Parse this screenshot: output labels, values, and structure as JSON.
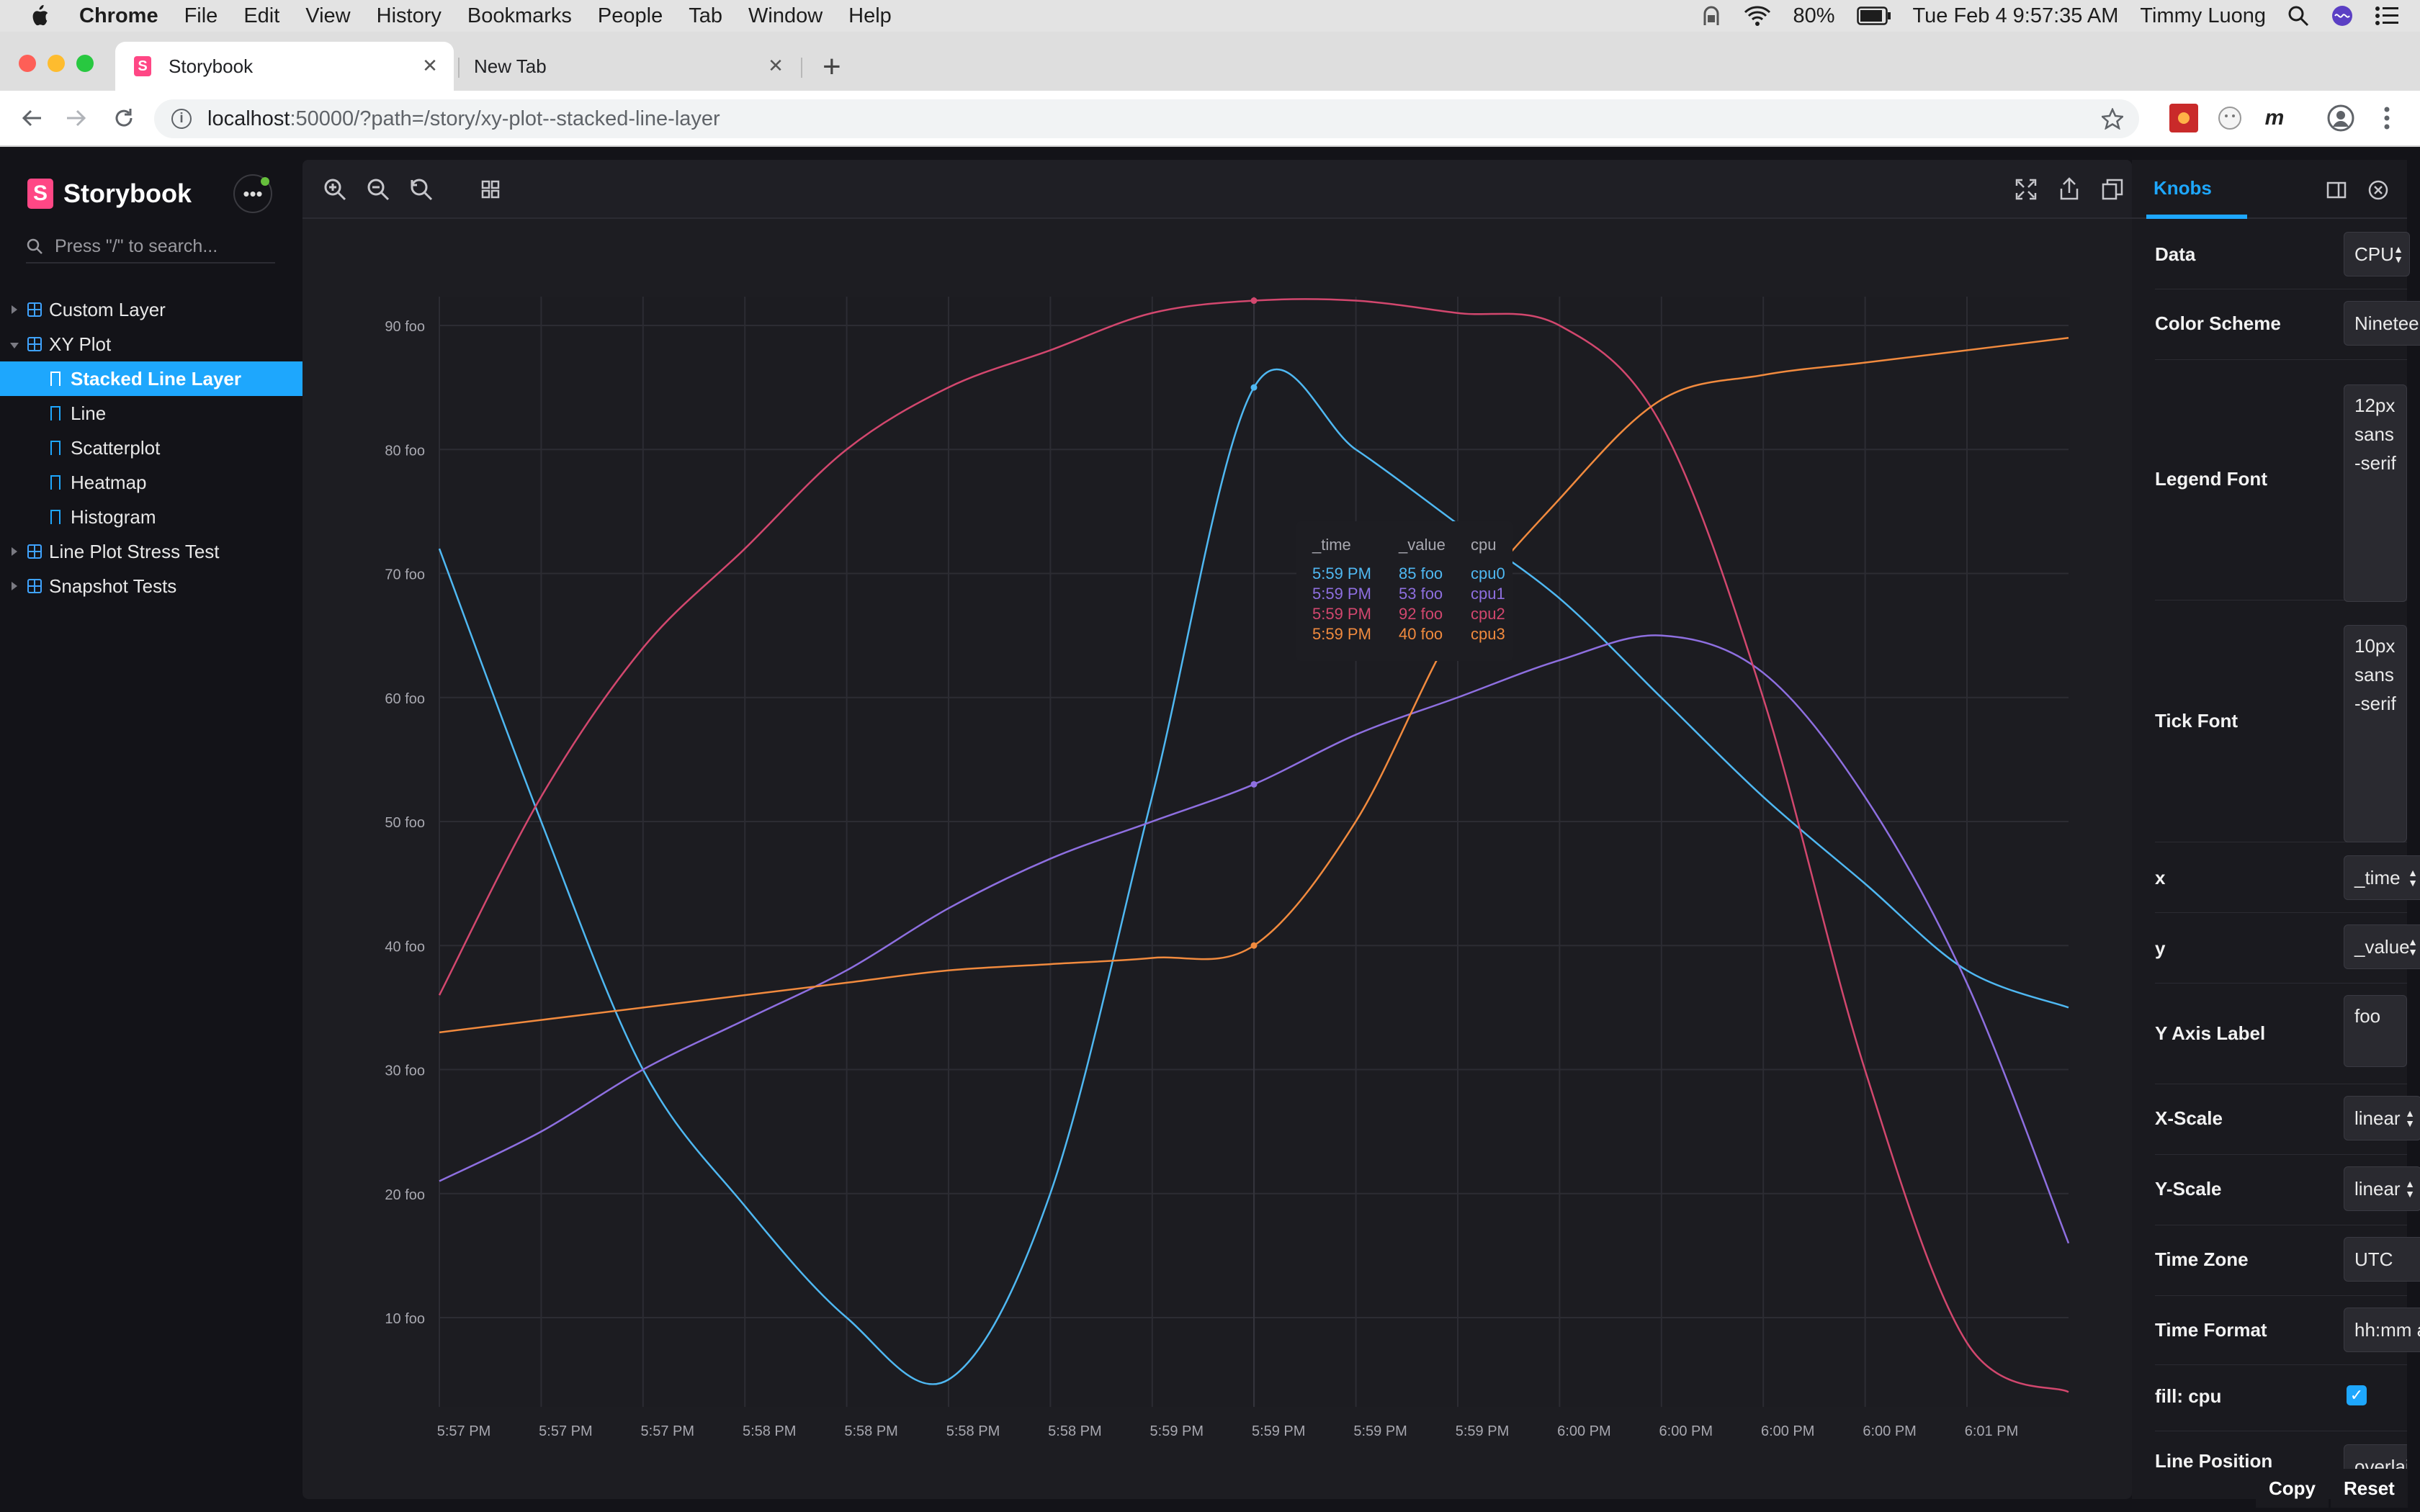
{
  "menubar": {
    "app": "Chrome",
    "items": [
      "File",
      "Edit",
      "View",
      "History",
      "Bookmarks",
      "People",
      "Tab",
      "Window",
      "Help"
    ],
    "battery": "80%",
    "datetime": "Tue Feb 4  9:57:35 AM",
    "user": "Timmy Luong"
  },
  "tabs": [
    {
      "title": "Storybook"
    },
    {
      "title": "New Tab"
    }
  ],
  "address": {
    "host": "localhost",
    "rest": ":50000/?path=/story/xy-plot--stacked-line-layer"
  },
  "extensions": {
    "m_label": "m"
  },
  "sidebar": {
    "brand": "Storybook",
    "search_placeholder": "Press \"/\" to search...",
    "tree": [
      {
        "label": "Custom Layer",
        "kind": "component"
      },
      {
        "label": "XY Plot",
        "kind": "component",
        "expanded": true
      },
      {
        "label": "Stacked Line Layer",
        "kind": "story",
        "selected": true
      },
      {
        "label": "Line",
        "kind": "story"
      },
      {
        "label": "Scatterplot",
        "kind": "story"
      },
      {
        "label": "Heatmap",
        "kind": "story"
      },
      {
        "label": "Histogram",
        "kind": "story"
      },
      {
        "label": "Line Plot Stress Test",
        "kind": "component"
      },
      {
        "label": "Snapshot Tests",
        "kind": "component"
      }
    ]
  },
  "knobs": {
    "tab": "Knobs",
    "rows": [
      {
        "label": "Data",
        "value": "CPU",
        "type": "select"
      },
      {
        "label": "Color Scheme",
        "value": "Nineteen",
        "type": "text"
      },
      {
        "label": "Legend Font",
        "value": "12px sans-serif",
        "type": "textarea"
      },
      {
        "label": "Tick Font",
        "value": "10px sans-serif",
        "type": "textarea"
      },
      {
        "label": "x",
        "value": "_time",
        "type": "select"
      },
      {
        "label": "y",
        "value": "_value",
        "type": "select"
      },
      {
        "label": "Y Axis Label",
        "value": "foo",
        "type": "textarea"
      },
      {
        "label": "X-Scale",
        "value": "linear",
        "type": "select"
      },
      {
        "label": "Y-Scale",
        "value": "linear",
        "type": "select"
      },
      {
        "label": "Time Zone",
        "value": "UTC",
        "type": "text"
      },
      {
        "label": "Time Format",
        "value": "hh:mm a",
        "type": "text"
      },
      {
        "label": "fill: cpu",
        "value": "✓",
        "type": "checkbox"
      },
      {
        "label": "Line Position",
        "value": "overlaid",
        "type": "select"
      }
    ],
    "copy": "Copy",
    "reset": "Reset"
  },
  "colors": {
    "cpu0": "#4fb8f2",
    "cpu1": "#8e6fe0",
    "cpu2": "#d2476e",
    "cpu3": "#f18a3e",
    "accent": "#1ea7fd"
  },
  "chart_data": {
    "type": "line",
    "ylabel": "",
    "ylim": [
      0,
      92
    ],
    "y_ticks": [
      "10 foo",
      "20 foo",
      "30 foo",
      "40 foo",
      "50 foo",
      "60 foo",
      "70 foo",
      "80 foo",
      "90 foo"
    ],
    "x_ticks": [
      "5:57 PM",
      "5:57 PM",
      "5:57 PM",
      "5:58 PM",
      "5:58 PM",
      "5:58 PM",
      "5:58 PM",
      "5:59 PM",
      "5:59 PM",
      "5:59 PM",
      "5:59 PM",
      "6:00 PM",
      "6:00 PM",
      "6:00 PM",
      "6:00 PM",
      "6:01 PM"
    ],
    "x": [
      0,
      2,
      4,
      6,
      8,
      10,
      12,
      14,
      16,
      18,
      20,
      22,
      24,
      26,
      28,
      30,
      32
    ],
    "series": [
      {
        "name": "cpu0",
        "values": [
          72,
          50,
          30,
          19,
          10,
          5,
          20,
          52,
          85,
          80,
          74,
          68,
          60,
          52,
          45,
          38,
          35
        ]
      },
      {
        "name": "cpu1",
        "values": [
          21,
          25,
          30,
          34,
          38,
          43,
          47,
          50,
          53,
          57,
          60,
          63,
          65,
          62,
          52,
          37,
          16
        ]
      },
      {
        "name": "cpu2",
        "values": [
          36,
          52,
          64,
          72,
          80,
          85,
          88,
          91,
          92,
          92,
          91,
          90,
          82,
          60,
          30,
          8,
          4
        ]
      },
      {
        "name": "cpu3",
        "values": [
          33,
          34,
          35,
          36,
          37,
          38,
          38.5,
          39,
          40,
          50,
          66,
          76,
          84,
          86,
          87,
          88,
          89
        ]
      }
    ],
    "tooltip": {
      "headers": [
        "_time",
        "_value",
        "cpu"
      ],
      "rows": [
        {
          "time": "5:59 PM",
          "value": "85 foo",
          "cpu": "cpu0"
        },
        {
          "time": "5:59 PM",
          "value": "53 foo",
          "cpu": "cpu1"
        },
        {
          "time": "5:59 PM",
          "value": "92 foo",
          "cpu": "cpu2"
        },
        {
          "time": "5:59 PM",
          "value": "40 foo",
          "cpu": "cpu3"
        }
      ]
    }
  }
}
